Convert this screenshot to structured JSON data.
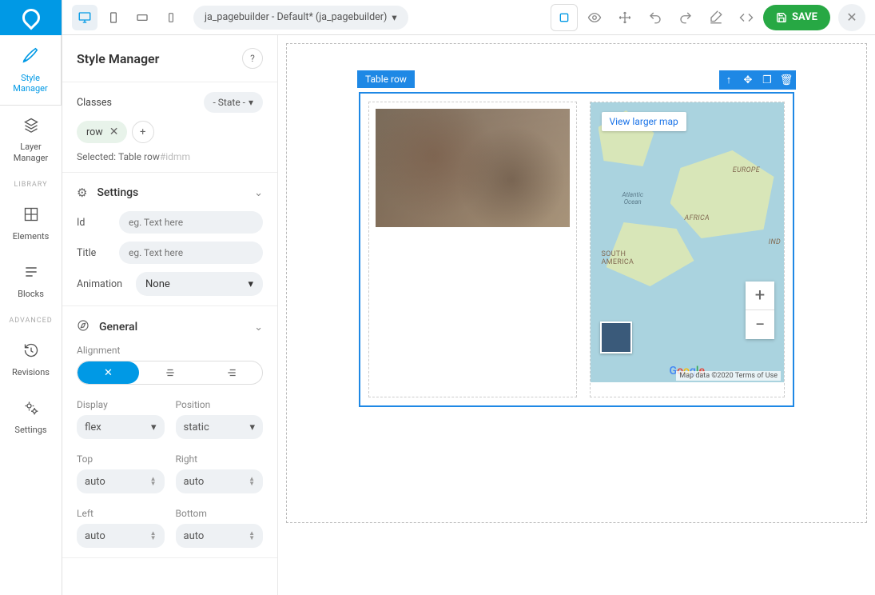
{
  "rail": {
    "style_manager": "Style\nManager",
    "layer_manager": "Layer\nManager",
    "library_divider": "LIBRARY",
    "elements": "Elements",
    "blocks": "Blocks",
    "advanced_divider": "ADVANCED",
    "revisions": "Revisions",
    "settings": "Settings"
  },
  "topbar": {
    "page_name": "ja_pagebuilder - Default* (ja_pagebuilder)",
    "save": "SAVE"
  },
  "panel": {
    "title": "Style Manager",
    "classes_label": "Classes",
    "state_label": "- State -",
    "chip_row": "row",
    "selected_label": "Selected:",
    "selected_value": "Table row",
    "selected_id": "#idmm",
    "settings": {
      "title": "Settings",
      "id_label": "Id",
      "id_placeholder": "eg. Text here",
      "title_label": "Title",
      "title_placeholder": "eg. Text here",
      "animation_label": "Animation",
      "animation_value": "None"
    },
    "general": {
      "title": "General",
      "alignment_label": "Alignment",
      "display_label": "Display",
      "display_value": "flex",
      "position_label": "Position",
      "position_value": "static",
      "top_label": "Top",
      "top_value": "auto",
      "right_label": "Right",
      "right_value": "auto",
      "left_label": "Left",
      "left_value": "auto",
      "bottom_label": "Bottom",
      "bottom_value": "auto"
    }
  },
  "canvas": {
    "row_label": "Table row",
    "map": {
      "view_larger": "View larger map",
      "labels": {
        "europe": "EUROPE",
        "africa": "AFRICA",
        "south_america": "SOUTH\nAMERICA",
        "atlantic": "Atlantic\nOcean",
        "ind": "IND"
      },
      "logo": "Google",
      "attribution": "Map data ©2020    Terms of Use"
    }
  }
}
